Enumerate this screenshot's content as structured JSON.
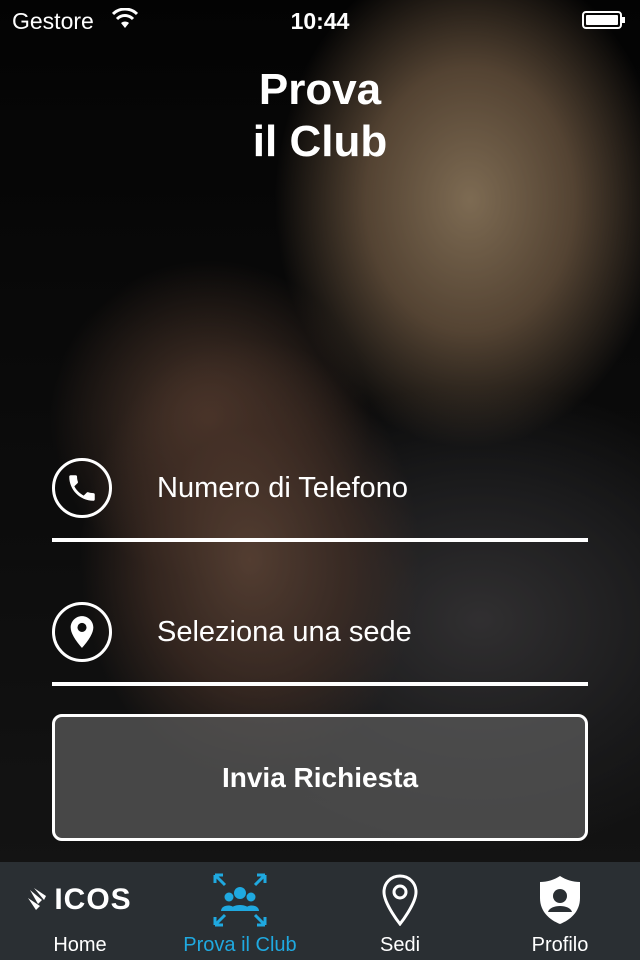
{
  "status_bar": {
    "carrier": "Gestore",
    "time": "10:44"
  },
  "header": {
    "title_line1": "Prova",
    "title_line2": "il Club"
  },
  "form": {
    "phone_placeholder": "Numero di Telefono",
    "location_placeholder": "Seleziona una sede",
    "submit_label": "Invia Richiesta"
  },
  "tabbar": {
    "logo_text": "ICOS",
    "items": [
      {
        "label": "Home",
        "icon": "icos-logo-icon",
        "active": false
      },
      {
        "label": "Prova il Club",
        "icon": "group-icon",
        "active": true
      },
      {
        "label": "Sedi",
        "icon": "map-pin-icon",
        "active": false
      },
      {
        "label": "Profilo",
        "icon": "shield-user-icon",
        "active": false
      }
    ]
  },
  "colors": {
    "accent": "#1fa9e0",
    "tabbar_bg": "#2a2f33"
  }
}
